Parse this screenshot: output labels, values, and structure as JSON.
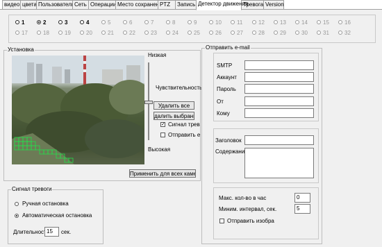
{
  "tabs": [
    {
      "label": "видео"
    },
    {
      "label": "цвета"
    },
    {
      "label": "Пользователи"
    },
    {
      "label": "Сеть"
    },
    {
      "label": "Операции"
    },
    {
      "label": "Место сохранения"
    },
    {
      "label": "PTZ"
    },
    {
      "label": "Запись"
    },
    {
      "label": "Детектор движения",
      "active": true
    },
    {
      "label": "Тревога"
    },
    {
      "label": "Version"
    }
  ],
  "channels": [
    {
      "label": "1",
      "enabled": true
    },
    {
      "label": "2",
      "enabled": true,
      "selected": true
    },
    {
      "label": "3",
      "enabled": true
    },
    {
      "label": "4",
      "enabled": true
    },
    {
      "label": "5"
    },
    {
      "label": "6"
    },
    {
      "label": "7"
    },
    {
      "label": "8"
    },
    {
      "label": "9"
    },
    {
      "label": "10"
    },
    {
      "label": "11"
    },
    {
      "label": "12"
    },
    {
      "label": "13"
    },
    {
      "label": "14"
    },
    {
      "label": "15"
    },
    {
      "label": "16"
    },
    {
      "label": "17"
    },
    {
      "label": "18"
    },
    {
      "label": "19"
    },
    {
      "label": "20"
    },
    {
      "label": "21"
    },
    {
      "label": "22"
    },
    {
      "label": "23"
    },
    {
      "label": "24"
    },
    {
      "label": "25"
    },
    {
      "label": "26"
    },
    {
      "label": "27"
    },
    {
      "label": "28"
    },
    {
      "label": "29"
    },
    {
      "label": "30"
    },
    {
      "label": "31"
    },
    {
      "label": "32"
    }
  ],
  "setup": {
    "title": "Установка",
    "low_label": "Низкая",
    "sensitivity_label": "Чувствительность",
    "high_label": "Высокая",
    "delete_all": "Удалить все",
    "delete_selected": "далить выбранны",
    "alarm_signal": "Сигнал тревоги",
    "alarm_signal_checked": true,
    "send_email": "Отправить е",
    "send_email_checked": false,
    "apply_all": "Применить для всех камер"
  },
  "alarm": {
    "title": "Сигнал тревоги",
    "manual_stop": "Ручная остановка",
    "auto_stop": "Автоматическая остановка",
    "duration_label": "Длительность",
    "duration_value": "15",
    "duration_unit": "сек."
  },
  "email": {
    "title": "Отправить e-mail",
    "smtp": "SMTP",
    "account": "Аккаунт",
    "password": "Пароль",
    "from": "От",
    "to": "Кому",
    "subject": "Заголовок",
    "content": "Содержание",
    "max_per_hour_label": "Макс. кол-во в час",
    "max_per_hour_value": "0",
    "min_interval_label": "Миним. интервал, сек.",
    "min_interval_value": "5",
    "send_image_label": "Отправить изобра",
    "send_image_checked": false
  }
}
